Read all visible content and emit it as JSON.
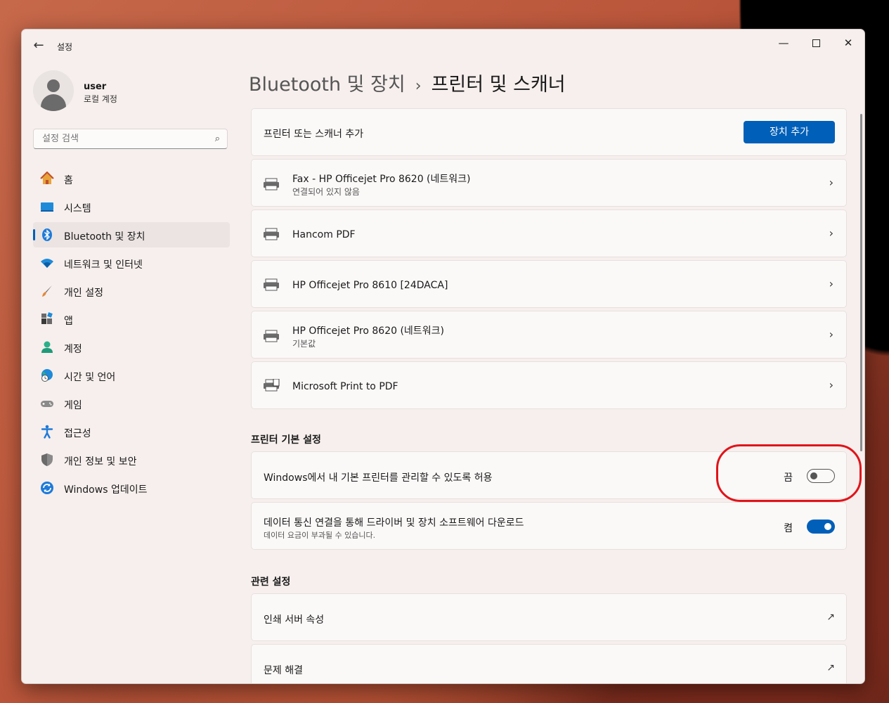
{
  "app": {
    "title": "설정"
  },
  "user": {
    "name": "user",
    "account_type": "로컬 계정"
  },
  "search": {
    "placeholder": "설정 검색"
  },
  "sidebar": {
    "items": [
      {
        "label": "홈",
        "icon": "home-icon"
      },
      {
        "label": "시스템",
        "icon": "system-icon"
      },
      {
        "label": "Bluetooth 및 장치",
        "icon": "bluetooth-icon",
        "active": true
      },
      {
        "label": "네트워크 및 인터넷",
        "icon": "wifi-icon"
      },
      {
        "label": "개인 설정",
        "icon": "brush-icon"
      },
      {
        "label": "앱",
        "icon": "apps-icon"
      },
      {
        "label": "계정",
        "icon": "account-icon"
      },
      {
        "label": "시간 및 언어",
        "icon": "globe-clock-icon"
      },
      {
        "label": "게임",
        "icon": "gamepad-icon"
      },
      {
        "label": "접근성",
        "icon": "accessibility-icon"
      },
      {
        "label": "개인 정보 및 보안",
        "icon": "shield-icon"
      },
      {
        "label": "Windows 업데이트",
        "icon": "update-icon"
      }
    ]
  },
  "breadcrumb": {
    "parent": "Bluetooth 및 장치",
    "separator": "›",
    "current": "프린터 및 스캐너"
  },
  "add_device": {
    "label": "프린터 또는 스캐너 추가",
    "button": "장치 추가"
  },
  "printers": [
    {
      "name": "Fax - HP Officejet Pro 8620 (네트워크)",
      "status": "연결되어 있지 않음"
    },
    {
      "name": "Hancom PDF",
      "status": ""
    },
    {
      "name": "HP Officejet Pro 8610 [24DACA]",
      "status": ""
    },
    {
      "name": "HP Officejet Pro 8620 (네트워크)",
      "status": "기본값"
    },
    {
      "name": "Microsoft Print to PDF",
      "status": ""
    }
  ],
  "printer_prefs": {
    "heading": "프린터 기본 설정",
    "manage_default": {
      "label": "Windows에서 내 기본 프린터를 관리할 수 있도록 허용",
      "state_label": "끔",
      "on": false
    },
    "metered_download": {
      "label": "데이터 통신 연결을 통해 드라이버 및 장치 소프트웨어 다운로드",
      "description": "데이터 요금이 부과될 수 있습니다.",
      "state_label": "켬",
      "on": true
    }
  },
  "related": {
    "heading": "관련 설정",
    "items": [
      {
        "label": "인쇄 서버 속성"
      },
      {
        "label": "문제 해결"
      }
    ]
  },
  "colors": {
    "accent": "#005fb8",
    "annotation": "#e0141a"
  }
}
